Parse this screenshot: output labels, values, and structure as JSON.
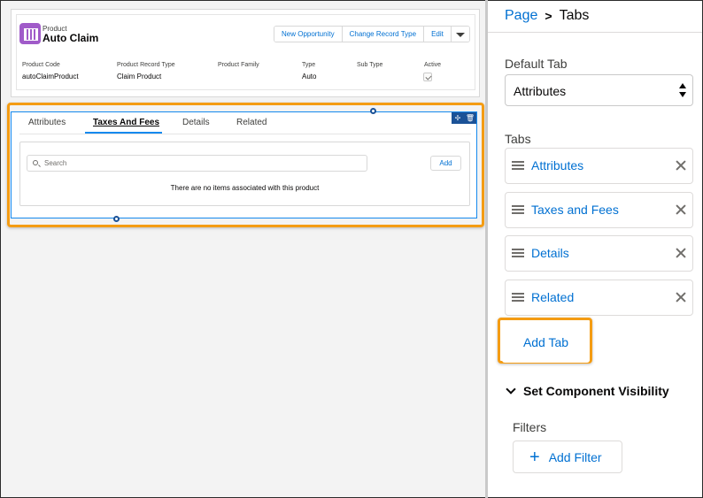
{
  "record": {
    "object_type": "Product",
    "name": "Auto Claim",
    "actions": [
      "New Opportunity",
      "Change Record Type",
      "Edit"
    ],
    "fields": [
      {
        "label": "Product Code",
        "value": "autoClaimProduct"
      },
      {
        "label": "Product Record Type",
        "value": "Claim Product"
      },
      {
        "label": "Product Family",
        "value": ""
      },
      {
        "label": "Type",
        "value": "Auto"
      },
      {
        "label": "Sub Type",
        "value": ""
      },
      {
        "label": "Active",
        "value": ""
      }
    ]
  },
  "tabs_component": {
    "tabs": [
      "Attributes",
      "Taxes And Fees",
      "Details",
      "Related"
    ],
    "active_tab": "Taxes And Fees",
    "tools": {
      "move": "✢",
      "delete": "🗑"
    },
    "search_placeholder": "Search",
    "add_label": "Add",
    "empty_message": "There are no items associated with this product"
  },
  "panel": {
    "breadcrumb": {
      "parent": "Page",
      "separator": ">",
      "current": "Tabs"
    },
    "default_tab_label": "Default Tab",
    "default_tab_value": "Attributes",
    "tabs_label": "Tabs",
    "tab_items": [
      "Attributes",
      "Taxes and Fees",
      "Details",
      "Related"
    ],
    "add_tab_label": "Add Tab",
    "visibility_section": "Set Component Visibility",
    "filters_label": "Filters",
    "add_filter_label": "Add Filter"
  },
  "colors": {
    "highlight": "#f49c13",
    "link": "#0070d2",
    "selection": "#1589ee",
    "product_icon": "#a05bc9"
  }
}
